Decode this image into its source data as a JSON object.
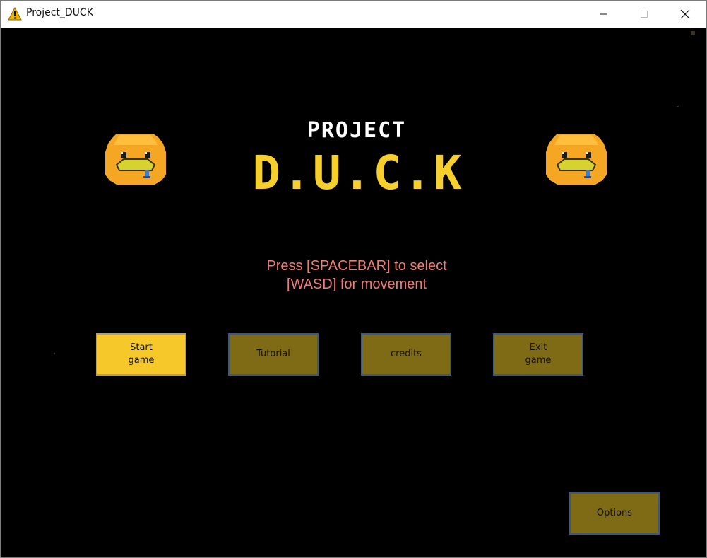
{
  "window": {
    "title": "Project_DUCK",
    "icon": "warning-triangle-icon",
    "controls": [
      "minimize-icon",
      "maximize-icon",
      "close-icon"
    ]
  },
  "game": {
    "title_top": "PROJECT",
    "title_main": "D.U.C.K",
    "instructions": [
      "Press [SPACEBAR] to select",
      "[WASD] for movement"
    ],
    "menu": [
      {
        "label": "Start\ngame",
        "selected": true
      },
      {
        "label": "Tutorial",
        "selected": false
      },
      {
        "label": "credits",
        "selected": false
      },
      {
        "label": "Exit\ngame",
        "selected": false
      }
    ],
    "options_label": "Options"
  },
  "colors": {
    "background": "#000000",
    "title_white": "#ffffff",
    "title_yellow": "#f6cf2d",
    "hint_text": "#f07c74",
    "button_selected": "#f6c82a",
    "button_normal": "#7f6a15",
    "button_border": "#3a5a86",
    "duck_body": "#f5a623",
    "duck_beak": "#d6d330",
    "duck_tongue": "#3a7bd5"
  }
}
